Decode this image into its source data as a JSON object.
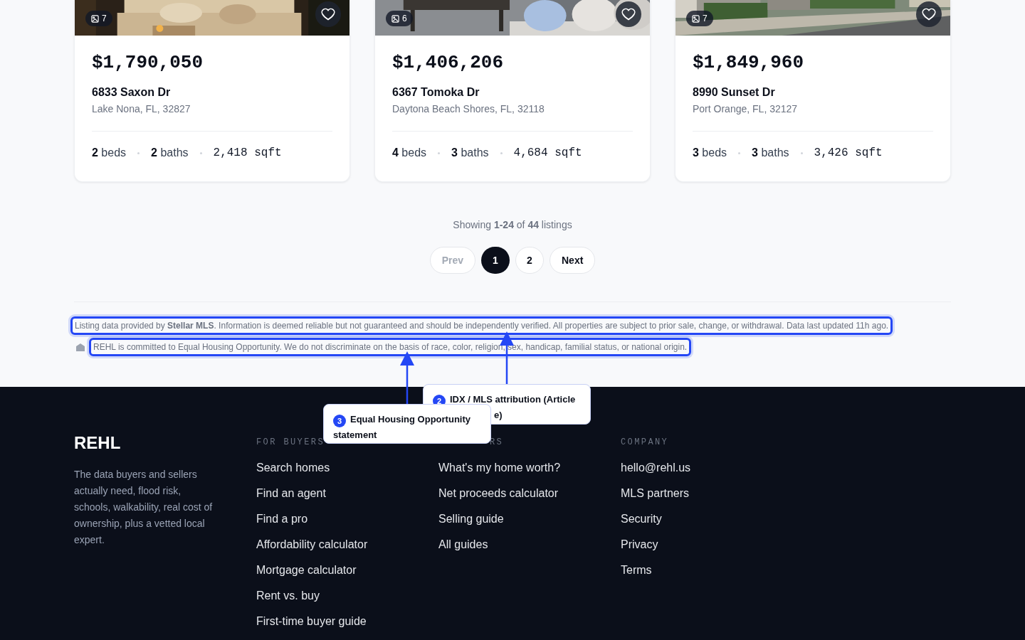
{
  "listings": [
    {
      "photo_count": "7",
      "favorite": false,
      "price": "$1,790,050",
      "address": "6833 Saxon Dr",
      "city": "Lake Nona, FL, 32827",
      "beds": "2",
      "beds_label": "beds",
      "baths": "2",
      "baths_label": "baths",
      "sqft": "2,418 sqft"
    },
    {
      "photo_count": "6",
      "favorite": false,
      "price": "$1,406,206",
      "address": "6367 Tomoka Dr",
      "city": "Daytona Beach Shores, FL, 32118",
      "beds": "4",
      "beds_label": "beds",
      "baths": "3",
      "baths_label": "baths",
      "sqft": "4,684 sqft"
    },
    {
      "photo_count": "7",
      "favorite": false,
      "price": "$1,849,960",
      "address": "8990 Sunset Dr",
      "city": "Port Orange, FL, 32127",
      "beds": "3",
      "beds_label": "beds",
      "baths": "3",
      "baths_label": "baths",
      "sqft": "3,426 sqft"
    }
  ],
  "results_summary": "Showing **1-24** of **44** listings",
  "pagination": {
    "prev": {
      "label": "Prev",
      "disabled": true
    },
    "pages": [
      {
        "label": "1",
        "selected": true
      },
      {
        "label": "2",
        "selected": false
      }
    ],
    "next": {
      "label": "Next",
      "disabled": false
    }
  },
  "disclaimers": [
    {
      "text": "Listing data provided by **Stellar MLS**. Information is deemed reliable but not guaranteed and should be independently verified. All properties are subject to prior sale, change, or withdrawal. Data last updated 11h ago.",
      "icon": false
    },
    {
      "text": "REHL is committed to Equal Housing Opportunity. We do not discriminate on the basis of race, color, religion, sex, handicap, familial status, or national origin.",
      "icon": true
    }
  ],
  "annotations": [
    {
      "number": "2",
      "lines": [
        "IDX / MLS attribution (Article",
        "e)"
      ]
    },
    {
      "number": "3",
      "lines": [
        "Equal Housing Opportunity",
        "statement"
      ]
    }
  ],
  "footer": {
    "brand": "REHL",
    "tagline": "The data buyers and sellers actually need, flood risk, schools, walkability, real cost of ownership, plus a vetted local expert.",
    "columns": [
      {
        "heading": "FOR BUYERS",
        "links": [
          "Search homes",
          "Find an agent",
          "Find a pro",
          "Affordability calculator",
          "Mortgage calculator",
          "Rent vs. buy",
          "First-time buyer guide"
        ]
      },
      {
        "heading": "RS",
        "links": [
          "What's my home worth?",
          "Net proceeds calculator",
          "Selling guide",
          "All guides"
        ]
      },
      {
        "heading": "COMPANY",
        "links": [
          "hello@rehl.us",
          "MLS partners",
          "Security",
          "Privacy",
          "Terms"
        ]
      }
    ]
  }
}
